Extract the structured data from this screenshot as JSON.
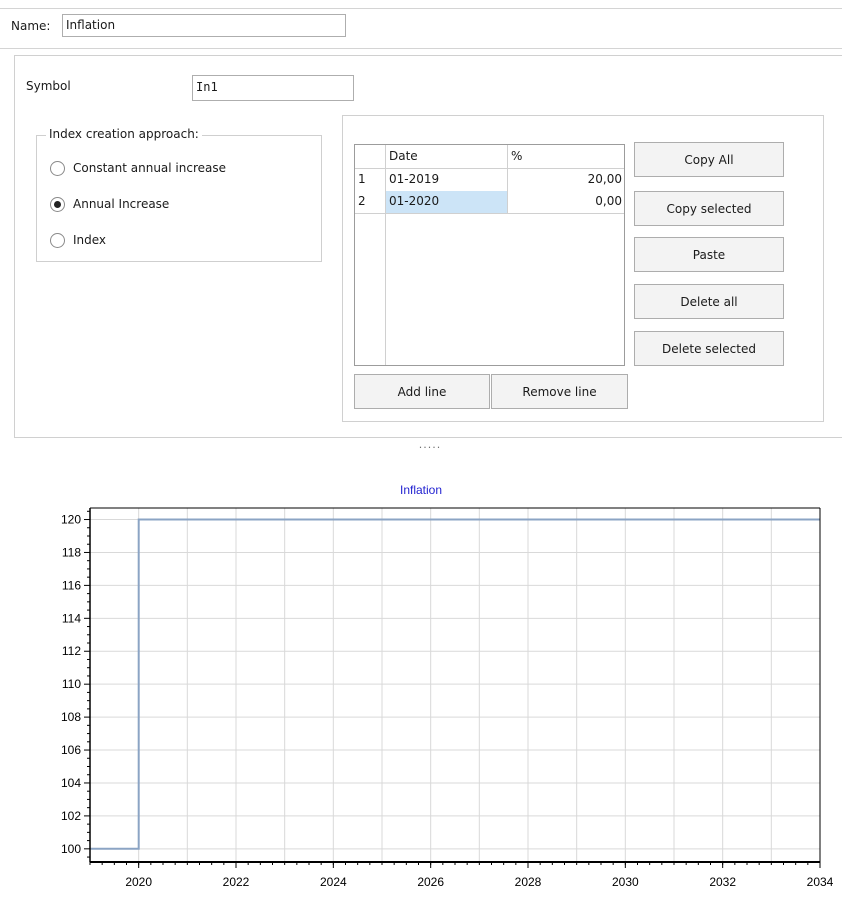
{
  "header": {
    "name_label": "Name:",
    "name_value": "Inflation"
  },
  "settings": {
    "symbol_label": "Symbol",
    "symbol_value": "In1",
    "approach_legend": "Index creation approach:",
    "options": [
      {
        "label": "Constant annual increase",
        "checked": false
      },
      {
        "label": "Annual Increase",
        "checked": true
      },
      {
        "label": "Index",
        "checked": false
      }
    ]
  },
  "table": {
    "columns": [
      "Date",
      "%"
    ],
    "rows": [
      {
        "index": "1",
        "date": "01-2019",
        "pct": "20,00"
      },
      {
        "index": "2",
        "date": "01-2020",
        "pct": "0,00"
      }
    ]
  },
  "buttons": {
    "copy_all": "Copy All",
    "copy_selected": "Copy selected",
    "paste": "Paste",
    "delete_all": "Delete all",
    "delete_selected": "Delete selected",
    "add_line": "Add line",
    "remove_line": "Remove line"
  },
  "splitter": "·····",
  "chart_data": {
    "type": "line",
    "title": "Inflation",
    "title_color": "#1f1fd0",
    "line_color": "#8ba4c4",
    "xlabel": "",
    "ylabel": "",
    "xlim": [
      2019,
      2034
    ],
    "ylim": [
      99.2,
      120.7
    ],
    "xticks": [
      2020,
      2022,
      2024,
      2026,
      2028,
      2030,
      2032,
      2034
    ],
    "yticks": [
      100,
      102,
      104,
      106,
      108,
      110,
      112,
      114,
      116,
      118,
      120
    ],
    "grid": true,
    "series": [
      {
        "x": [
          2019,
          2020,
          2020,
          2034
        ],
        "values": [
          100,
          100,
          120,
          120
        ]
      }
    ]
  }
}
